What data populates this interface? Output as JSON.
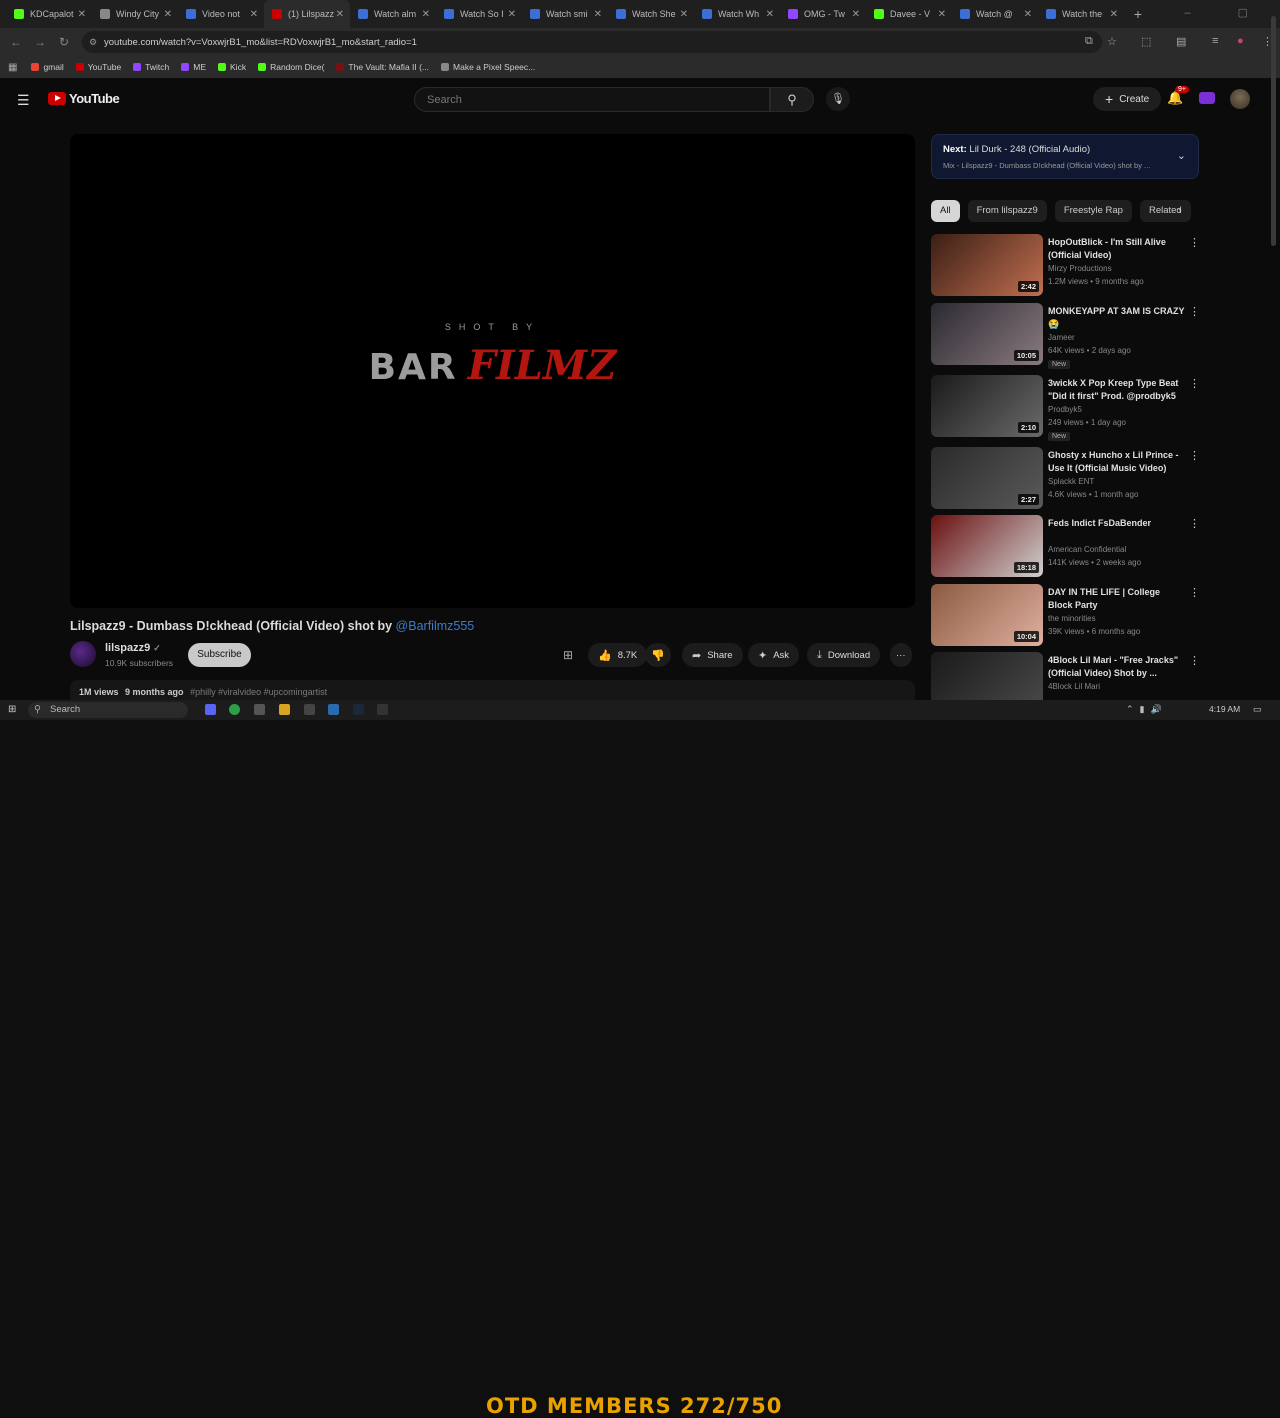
{
  "tabs": [
    {
      "label": "KDCapalot",
      "color": "#53fc18"
    },
    {
      "label": "Windy City",
      "color": "#888888"
    },
    {
      "label": "Video not",
      "color": "#3b6fd6"
    },
    {
      "label": "(1) Lilspazz",
      "color": "#cc0000"
    },
    {
      "label": "Watch alm",
      "color": "#3b6fd6"
    },
    {
      "label": "Watch So I",
      "color": "#3b6fd6"
    },
    {
      "label": "Watch smi",
      "color": "#3b6fd6"
    },
    {
      "label": "Watch She",
      "color": "#3b6fd6"
    },
    {
      "label": "Watch Wh",
      "color": "#3b6fd6"
    },
    {
      "label": "OMG - Tw",
      "color": "#9146ff"
    },
    {
      "label": "Davee - V",
      "color": "#53fc18"
    },
    {
      "label": "Watch @",
      "color": "#3b6fd6"
    },
    {
      "label": "Watch the",
      "color": "#3b6fd6"
    }
  ],
  "url": "youtube.com/watch?v=VoxwjrB1_mo&list=RDVoxwjrB1_mo&start_radio=1",
  "bookmarks": [
    {
      "label": "gmail",
      "color": "#ea4335"
    },
    {
      "label": "YouTube",
      "color": "#cc0000"
    },
    {
      "label": "Twitch",
      "color": "#9146ff"
    },
    {
      "label": "ME",
      "color": "#9146ff"
    },
    {
      "label": "Kick",
      "color": "#53fc18"
    },
    {
      "label": "Random Dice(",
      "color": "#53fc18"
    },
    {
      "label": "The Vault: Mafia II (...",
      "color": "#7a1010"
    },
    {
      "label": "Make a Pixel Speec...",
      "color": "#888888"
    }
  ],
  "header": {
    "logo": "YouTube",
    "search_placeholder": "Search",
    "create": "Create",
    "notif_count": "9+"
  },
  "player": {
    "shot_by": "SHOT BY",
    "brand_a": "BAR",
    "brand_b": "FILMZ"
  },
  "video": {
    "title": "Lilspazz9 - Dumbass D!ckhead (Official Video) shot by",
    "title_link": "@Barfilmz555",
    "channel": "lilspazz9",
    "subs": "10.9K subscribers",
    "subscribe": "Subscribe",
    "likes": "8.7K",
    "share": "Share",
    "ask": "Ask",
    "download": "Download",
    "views": "1M views",
    "age": "9 months ago",
    "tags": "#philly #viralvideo #upcomingartist"
  },
  "upnext": {
    "next_label": "Next:",
    "next_title": "Lil Durk - 248 (Official Audio)",
    "sub": "Mix - Lilspazz9 - Dumbass D!ckhead (Official Video) shot by ..."
  },
  "chips": [
    "All",
    "From lilspazz9",
    "Freestyle Rap",
    "Related"
  ],
  "recs": [
    {
      "title": "HopOutBlick - I'm Still Alive (Official Video)",
      "channel": "Mirzy Productions",
      "meta": "1.2M views • 9 months ago",
      "dur": "2:42",
      "new": "",
      "c1": "#3b1e14",
      "c2": "#c07050"
    },
    {
      "title": "MONKEYAPP AT 3AM IS CRAZY 😭",
      "channel": "Jameer",
      "meta": "64K views • 2 days ago",
      "dur": "10:05",
      "new": "New",
      "c1": "#2a2a30",
      "c2": "#8a7a80"
    },
    {
      "title": "3wickk X Pop Kreep Type Beat \"Did it first\" Prod. @prodbyk5",
      "channel": "Prodbyk5",
      "meta": "249 views • 1 day ago",
      "dur": "2:10",
      "new": "New",
      "c1": "#1a1a1a",
      "c2": "#6a6a6a"
    },
    {
      "title": "Ghosty x Huncho x Lil Prince - Use It (Official Music Video)",
      "channel": "Splackk ENT",
      "meta": "4.6K views • 1 month ago",
      "dur": "2:27",
      "new": "",
      "c1": "#2a2a2a",
      "c2": "#5a5a5a"
    },
    {
      "title": "Feds Indict FsDaBender",
      "channel": "American Confidential",
      "meta": "141K views • 2 weeks ago",
      "dur": "18:18",
      "new": "",
      "c1": "#6a1010",
      "c2": "#d0d0d0"
    },
    {
      "title": "DAY IN THE LIFE | College Block Party",
      "channel": "the minorities",
      "meta": "39K views • 6 months ago",
      "dur": "10:04",
      "new": "",
      "c1": "#8a5a40",
      "c2": "#e0b0a0"
    },
    {
      "title": "4Block Lil Mari - \"Free Jracks\" (Official Video) Shot by ...",
      "channel": "4Block Lil Mari",
      "meta": "",
      "dur": "",
      "new": "",
      "c1": "#1a1a1a",
      "c2": "#4a4a4a"
    }
  ],
  "taskbar": {
    "search": "Search",
    "overlay": "OTD MEMBERS 272/750",
    "clock": "4:19 AM"
  }
}
